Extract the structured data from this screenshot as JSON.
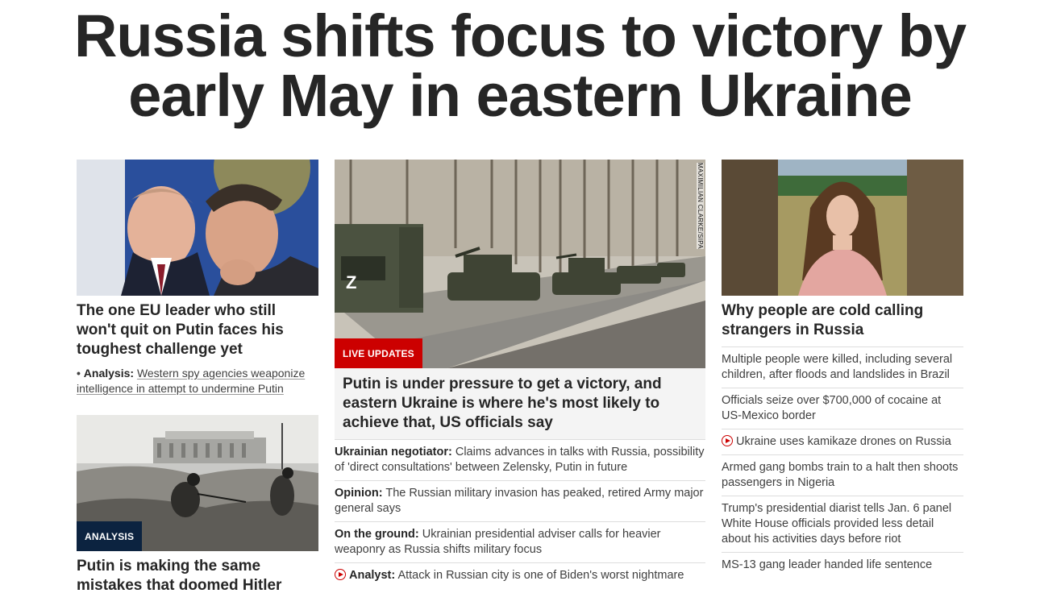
{
  "headline": "Russia shifts focus to victory by early May in eastern Ukraine",
  "left": {
    "card1": {
      "title": "The one EU leader who still won't quit on Putin faces his toughest challenge yet",
      "sub_lead": "Analysis:",
      "sub_text": "Western spy agencies weaponize intelligence in attempt to undermine Putin"
    },
    "card2": {
      "badge": "ANALYSIS",
      "title": "Putin is making the same mistakes that doomed Hitler"
    }
  },
  "middle": {
    "badge": "LIVE UPDATES",
    "photo_credit": "MAXIMILIAN CLARKE/SIPA",
    "title": "Putin is under pressure to get a victory, and eastern Ukraine is where he's most likely to achieve that, US officials say",
    "items": [
      {
        "lead": "Ukrainian negotiator:",
        "text": "Claims advances in talks with Russia, possibility of 'direct consultations' between Zelensky, Putin in future"
      },
      {
        "lead": "Opinion:",
        "text": "The Russian military invasion has peaked, retired Army major general says"
      },
      {
        "lead": "On the ground:",
        "text": "Ukrainian presidential adviser calls for heavier weaponry as Russia shifts military focus"
      },
      {
        "lead": "Analyst:",
        "text": "Attack in Russian city is one of Biden's worst nightmare"
      }
    ]
  },
  "right": {
    "title": "Why people are cold calling strangers in Russia",
    "items": [
      "Multiple people were killed, including several children, after floods and landslides in Brazil",
      "Officials seize over $700,000 of cocaine at US-Mexico border",
      "Ukraine uses kamikaze drones on Russia",
      "Armed gang bombs train to a halt then shoots passengers in Nigeria",
      "Trump's presidential diarist tells Jan. 6 panel White House officials provided less detail about his activities days before riot",
      "MS-13 gang leader handed life sentence"
    ]
  },
  "colors": {
    "text": "#262626",
    "live_red": "#cc0000",
    "analysis_navy": "#0c2340",
    "divider": "#dddddd"
  }
}
